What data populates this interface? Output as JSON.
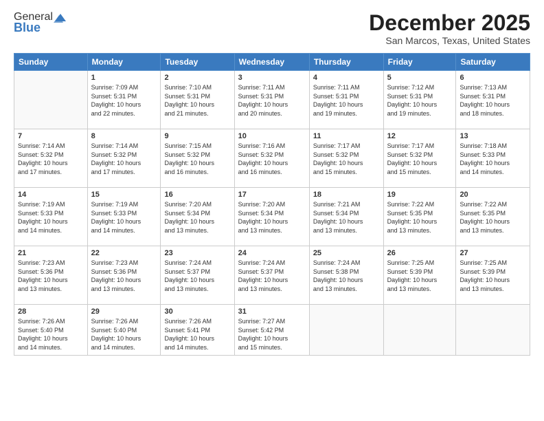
{
  "header": {
    "logo_general": "General",
    "logo_blue": "Blue",
    "month_title": "December 2025",
    "location": "San Marcos, Texas, United States"
  },
  "weekdays": [
    "Sunday",
    "Monday",
    "Tuesday",
    "Wednesday",
    "Thursday",
    "Friday",
    "Saturday"
  ],
  "weeks": [
    [
      {
        "day": "",
        "info": ""
      },
      {
        "day": "1",
        "info": "Sunrise: 7:09 AM\nSunset: 5:31 PM\nDaylight: 10 hours\nand 22 minutes."
      },
      {
        "day": "2",
        "info": "Sunrise: 7:10 AM\nSunset: 5:31 PM\nDaylight: 10 hours\nand 21 minutes."
      },
      {
        "day": "3",
        "info": "Sunrise: 7:11 AM\nSunset: 5:31 PM\nDaylight: 10 hours\nand 20 minutes."
      },
      {
        "day": "4",
        "info": "Sunrise: 7:11 AM\nSunset: 5:31 PM\nDaylight: 10 hours\nand 19 minutes."
      },
      {
        "day": "5",
        "info": "Sunrise: 7:12 AM\nSunset: 5:31 PM\nDaylight: 10 hours\nand 19 minutes."
      },
      {
        "day": "6",
        "info": "Sunrise: 7:13 AM\nSunset: 5:31 PM\nDaylight: 10 hours\nand 18 minutes."
      }
    ],
    [
      {
        "day": "7",
        "info": "Sunrise: 7:14 AM\nSunset: 5:32 PM\nDaylight: 10 hours\nand 17 minutes."
      },
      {
        "day": "8",
        "info": "Sunrise: 7:14 AM\nSunset: 5:32 PM\nDaylight: 10 hours\nand 17 minutes."
      },
      {
        "day": "9",
        "info": "Sunrise: 7:15 AM\nSunset: 5:32 PM\nDaylight: 10 hours\nand 16 minutes."
      },
      {
        "day": "10",
        "info": "Sunrise: 7:16 AM\nSunset: 5:32 PM\nDaylight: 10 hours\nand 16 minutes."
      },
      {
        "day": "11",
        "info": "Sunrise: 7:17 AM\nSunset: 5:32 PM\nDaylight: 10 hours\nand 15 minutes."
      },
      {
        "day": "12",
        "info": "Sunrise: 7:17 AM\nSunset: 5:32 PM\nDaylight: 10 hours\nand 15 minutes."
      },
      {
        "day": "13",
        "info": "Sunrise: 7:18 AM\nSunset: 5:33 PM\nDaylight: 10 hours\nand 14 minutes."
      }
    ],
    [
      {
        "day": "14",
        "info": "Sunrise: 7:19 AM\nSunset: 5:33 PM\nDaylight: 10 hours\nand 14 minutes."
      },
      {
        "day": "15",
        "info": "Sunrise: 7:19 AM\nSunset: 5:33 PM\nDaylight: 10 hours\nand 14 minutes."
      },
      {
        "day": "16",
        "info": "Sunrise: 7:20 AM\nSunset: 5:34 PM\nDaylight: 10 hours\nand 13 minutes."
      },
      {
        "day": "17",
        "info": "Sunrise: 7:20 AM\nSunset: 5:34 PM\nDaylight: 10 hours\nand 13 minutes."
      },
      {
        "day": "18",
        "info": "Sunrise: 7:21 AM\nSunset: 5:34 PM\nDaylight: 10 hours\nand 13 minutes."
      },
      {
        "day": "19",
        "info": "Sunrise: 7:22 AM\nSunset: 5:35 PM\nDaylight: 10 hours\nand 13 minutes."
      },
      {
        "day": "20",
        "info": "Sunrise: 7:22 AM\nSunset: 5:35 PM\nDaylight: 10 hours\nand 13 minutes."
      }
    ],
    [
      {
        "day": "21",
        "info": "Sunrise: 7:23 AM\nSunset: 5:36 PM\nDaylight: 10 hours\nand 13 minutes."
      },
      {
        "day": "22",
        "info": "Sunrise: 7:23 AM\nSunset: 5:36 PM\nDaylight: 10 hours\nand 13 minutes."
      },
      {
        "day": "23",
        "info": "Sunrise: 7:24 AM\nSunset: 5:37 PM\nDaylight: 10 hours\nand 13 minutes."
      },
      {
        "day": "24",
        "info": "Sunrise: 7:24 AM\nSunset: 5:37 PM\nDaylight: 10 hours\nand 13 minutes."
      },
      {
        "day": "25",
        "info": "Sunrise: 7:24 AM\nSunset: 5:38 PM\nDaylight: 10 hours\nand 13 minutes."
      },
      {
        "day": "26",
        "info": "Sunrise: 7:25 AM\nSunset: 5:39 PM\nDaylight: 10 hours\nand 13 minutes."
      },
      {
        "day": "27",
        "info": "Sunrise: 7:25 AM\nSunset: 5:39 PM\nDaylight: 10 hours\nand 13 minutes."
      }
    ],
    [
      {
        "day": "28",
        "info": "Sunrise: 7:26 AM\nSunset: 5:40 PM\nDaylight: 10 hours\nand 14 minutes."
      },
      {
        "day": "29",
        "info": "Sunrise: 7:26 AM\nSunset: 5:40 PM\nDaylight: 10 hours\nand 14 minutes."
      },
      {
        "day": "30",
        "info": "Sunrise: 7:26 AM\nSunset: 5:41 PM\nDaylight: 10 hours\nand 14 minutes."
      },
      {
        "day": "31",
        "info": "Sunrise: 7:27 AM\nSunset: 5:42 PM\nDaylight: 10 hours\nand 15 minutes."
      },
      {
        "day": "",
        "info": ""
      },
      {
        "day": "",
        "info": ""
      },
      {
        "day": "",
        "info": ""
      }
    ]
  ]
}
